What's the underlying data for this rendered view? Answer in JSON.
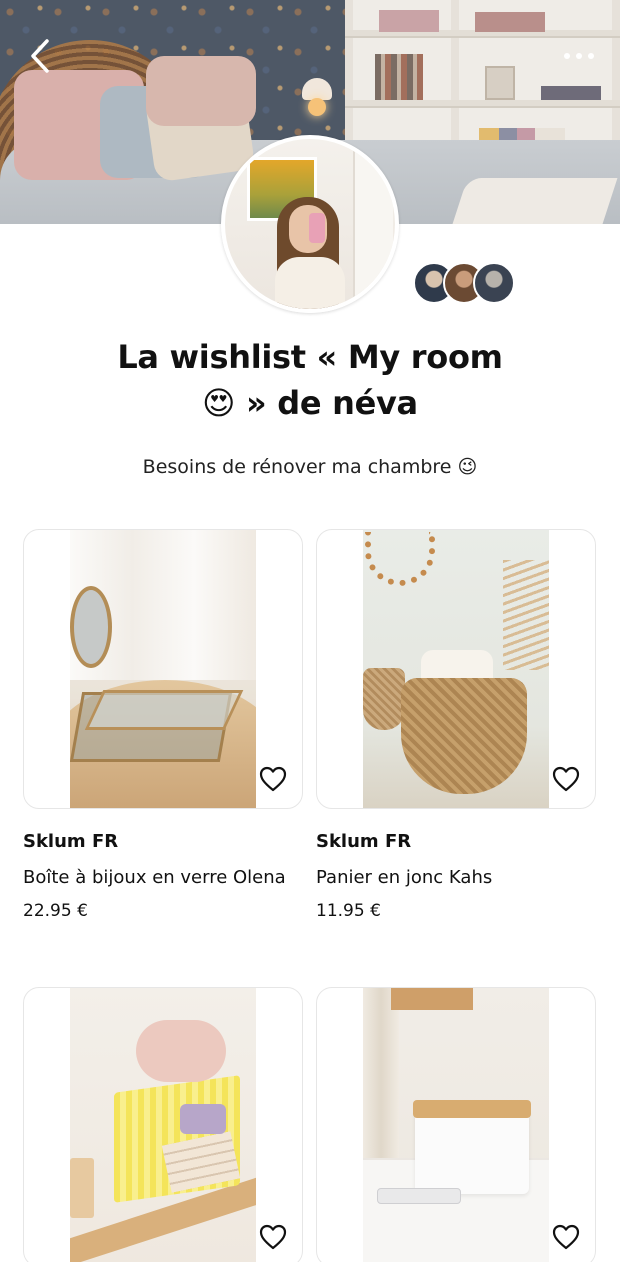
{
  "header": {
    "back_icon": "chevron-left-icon",
    "more_icon": "more-horizontal-icon"
  },
  "wishlist": {
    "title_line1": "La wishlist « My room",
    "title_line2": "😍 » de néva",
    "description": "Besoins de rénover ma chambre 😉"
  },
  "products": [
    {
      "brand": "Sklum FR",
      "name": "Boîte à bijoux en verre Olena",
      "price": "22.95 €",
      "favorite_icon": "heart-outline-icon"
    },
    {
      "brand": "Sklum FR",
      "name": "Panier en jonc Kahs",
      "price": "11.95 €",
      "favorite_icon": "heart-outline-icon"
    },
    {
      "brand": "",
      "name": "",
      "price": "",
      "favorite_icon": "heart-outline-icon"
    },
    {
      "brand": "",
      "name": "",
      "price": "",
      "favorite_icon": "heart-outline-icon"
    }
  ],
  "colors": {
    "text": "#111111",
    "card_border": "#e6e6e6",
    "background": "#ffffff"
  }
}
